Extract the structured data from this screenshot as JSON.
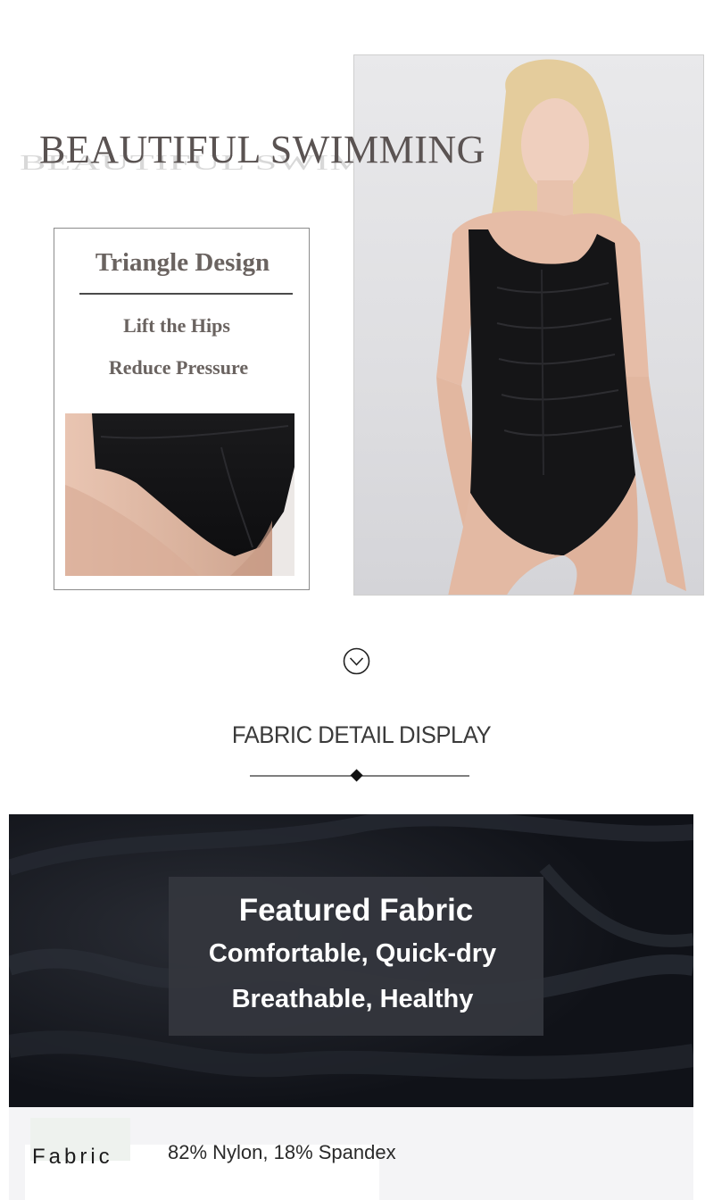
{
  "headline": "BEAUTIFUL SWIMMING",
  "feature_card": {
    "title": "Triangle Design",
    "line1": "Lift the Hips",
    "line2": "Reduce Pressure"
  },
  "section": {
    "title": "FABRIC DETAIL DISPLAY"
  },
  "fabric_overlay": {
    "title": "Featured Fabric",
    "line1": "Comfortable, Quick-dry",
    "line2": "Breathable, Healthy"
  },
  "spec": {
    "label": "Fabric",
    "value": "82% Nylon, 18% Spandex"
  },
  "colors": {
    "text_warm_gray": "#6a6360",
    "swimsuit_black": "#141416",
    "overlay_bg": "#34363d"
  },
  "icons": {
    "scroll": "chevron-down-circle-icon",
    "divider": "diamond-icon"
  }
}
